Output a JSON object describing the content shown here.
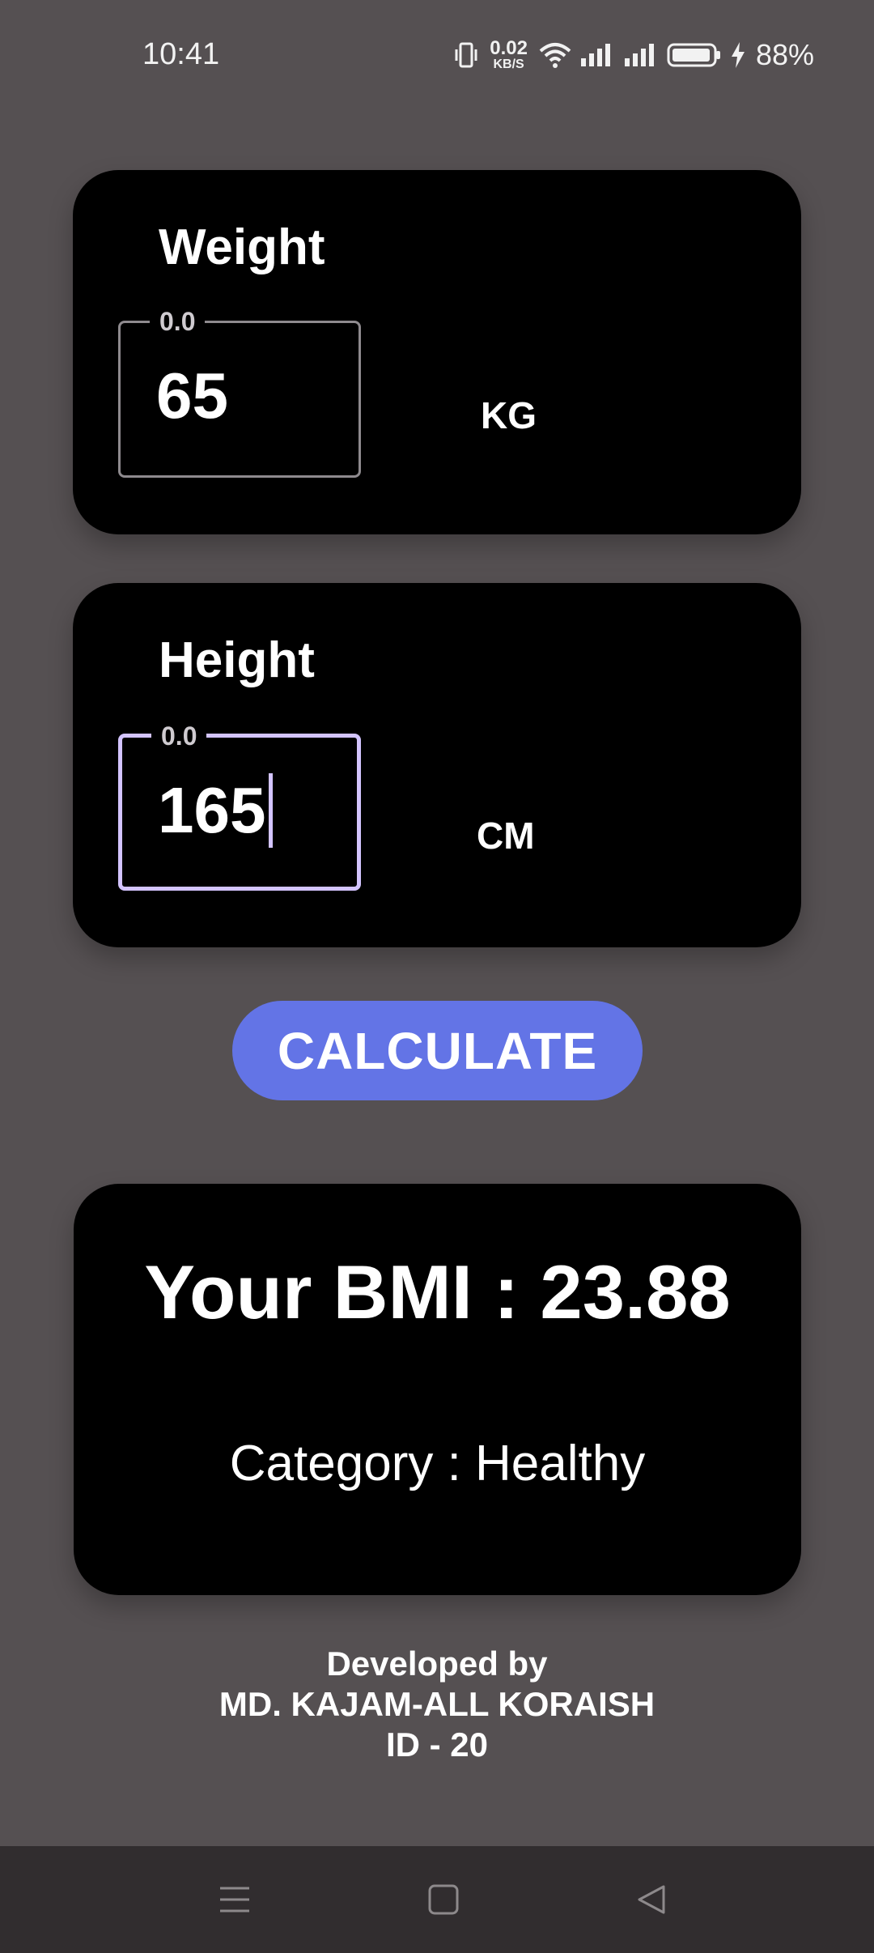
{
  "status_bar": {
    "time": "10:41",
    "net_speed_value": "0.02",
    "net_speed_unit": "KB/S",
    "battery_percent": "88%",
    "icons": [
      "vibrate-icon",
      "wifi-icon",
      "signal-icon",
      "signal-icon",
      "battery-icon",
      "charging-icon"
    ]
  },
  "weight_card": {
    "title": "Weight",
    "field_label": "0.0",
    "field_value": "65",
    "unit": "KG"
  },
  "height_card": {
    "title": "Height",
    "field_label": "0.0",
    "field_value": "165",
    "unit": "CM"
  },
  "calculate_button": {
    "label": "CALCULATE"
  },
  "result_card": {
    "bmi_text": "Your BMI : 23.88",
    "category_text": "Category : Healthy"
  },
  "footer": {
    "line1": "Developed by",
    "line2": "MD. KAJAM-ALL KORAISH",
    "line3": "ID - 20"
  },
  "nav_bar": {
    "icons": [
      "menu-icon",
      "home-icon",
      "back-icon"
    ]
  },
  "colors": {
    "background": "#555052",
    "card": "#000000",
    "accent_button": "#6374e6",
    "focus_outline": "#d3c4ff",
    "nav_bar": "#312d2f"
  }
}
